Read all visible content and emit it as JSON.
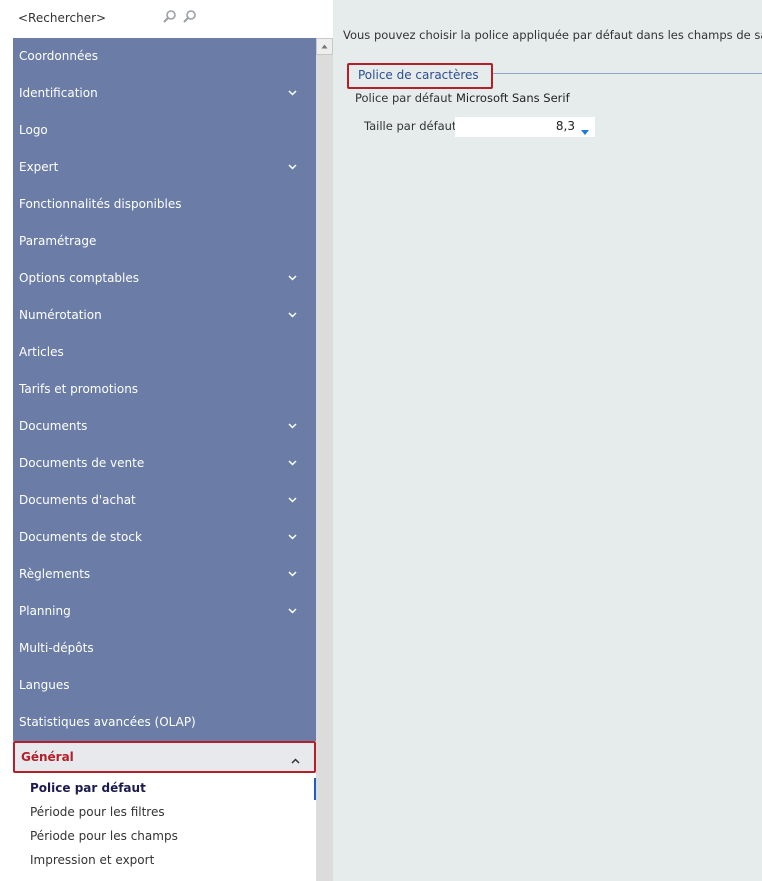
{
  "search": {
    "placeholder": "<Rechercher>",
    "icons": [
      "search-previous-icon",
      "search-next-icon"
    ]
  },
  "sidebar": {
    "items": [
      {
        "label": "Coordonnées",
        "expandable": false
      },
      {
        "label": "Identification",
        "expandable": true
      },
      {
        "label": "Logo",
        "expandable": false
      },
      {
        "label": "Expert",
        "expandable": true
      },
      {
        "label": "Fonctionnalités disponibles",
        "expandable": false
      },
      {
        "label": "Paramétrage",
        "expandable": false
      },
      {
        "label": "Options comptables",
        "expandable": true
      },
      {
        "label": "Numérotation",
        "expandable": true
      },
      {
        "label": "Articles",
        "expandable": false
      },
      {
        "label": "Tarifs et promotions",
        "expandable": false
      },
      {
        "label": "Documents",
        "expandable": true
      },
      {
        "label": "Documents de vente",
        "expandable": true
      },
      {
        "label": "Documents d'achat",
        "expandable": true
      },
      {
        "label": "Documents de stock",
        "expandable": true
      },
      {
        "label": "Règlements",
        "expandable": true
      },
      {
        "label": "Planning",
        "expandable": true
      },
      {
        "label": "Multi-dépôts",
        "expandable": false
      },
      {
        "label": "Langues",
        "expandable": false
      },
      {
        "label": "Statistiques avancées (OLAP)",
        "expandable": false
      }
    ],
    "expanded": {
      "label": "Général",
      "subitems": [
        "Police par défaut",
        "Période pour les filtres",
        "Période pour les champs",
        "Impression et export"
      ],
      "active_index": 0
    }
  },
  "content": {
    "intro": "Vous pouvez choisir la police appliquée par défaut dans les champs de saisi",
    "group_title": "Police de caractères",
    "font_label": "Police par défaut",
    "font_value": "Microsoft Sans Serif",
    "size_label": "Taille par défaut",
    "size_value": "8,3"
  },
  "colors": {
    "sidebar_bg": "#6b7da6",
    "content_bg": "#e6eceb",
    "highlight_border": "#b3202a",
    "accent_blue": "#1d5fbf"
  }
}
